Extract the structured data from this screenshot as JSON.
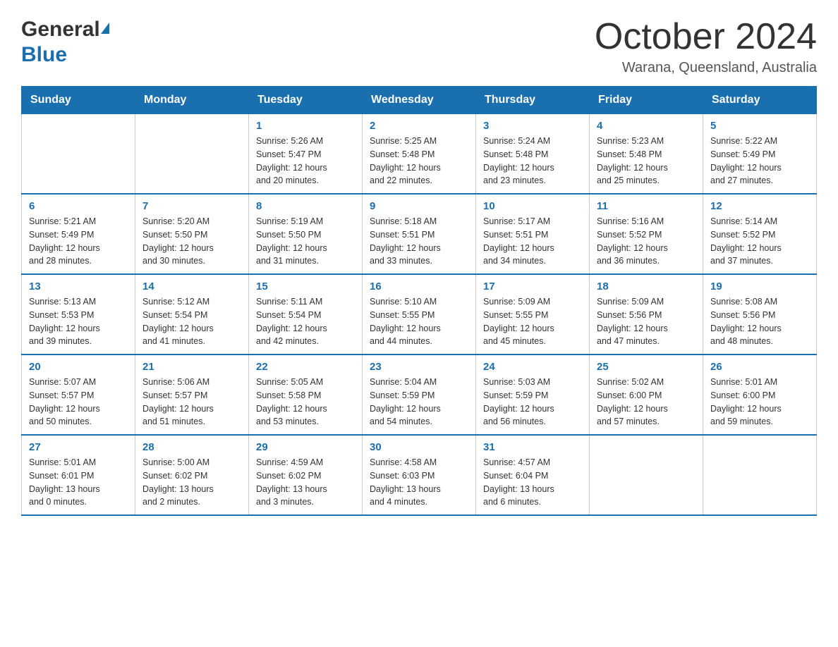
{
  "header": {
    "logo_general": "General",
    "logo_blue": "Blue",
    "month_title": "October 2024",
    "location": "Warana, Queensland, Australia"
  },
  "days_of_week": [
    "Sunday",
    "Monday",
    "Tuesday",
    "Wednesday",
    "Thursday",
    "Friday",
    "Saturday"
  ],
  "weeks": [
    [
      {
        "day": "",
        "info": ""
      },
      {
        "day": "",
        "info": ""
      },
      {
        "day": "1",
        "info": "Sunrise: 5:26 AM\nSunset: 5:47 PM\nDaylight: 12 hours\nand 20 minutes."
      },
      {
        "day": "2",
        "info": "Sunrise: 5:25 AM\nSunset: 5:48 PM\nDaylight: 12 hours\nand 22 minutes."
      },
      {
        "day": "3",
        "info": "Sunrise: 5:24 AM\nSunset: 5:48 PM\nDaylight: 12 hours\nand 23 minutes."
      },
      {
        "day": "4",
        "info": "Sunrise: 5:23 AM\nSunset: 5:48 PM\nDaylight: 12 hours\nand 25 minutes."
      },
      {
        "day": "5",
        "info": "Sunrise: 5:22 AM\nSunset: 5:49 PM\nDaylight: 12 hours\nand 27 minutes."
      }
    ],
    [
      {
        "day": "6",
        "info": "Sunrise: 5:21 AM\nSunset: 5:49 PM\nDaylight: 12 hours\nand 28 minutes."
      },
      {
        "day": "7",
        "info": "Sunrise: 5:20 AM\nSunset: 5:50 PM\nDaylight: 12 hours\nand 30 minutes."
      },
      {
        "day": "8",
        "info": "Sunrise: 5:19 AM\nSunset: 5:50 PM\nDaylight: 12 hours\nand 31 minutes."
      },
      {
        "day": "9",
        "info": "Sunrise: 5:18 AM\nSunset: 5:51 PM\nDaylight: 12 hours\nand 33 minutes."
      },
      {
        "day": "10",
        "info": "Sunrise: 5:17 AM\nSunset: 5:51 PM\nDaylight: 12 hours\nand 34 minutes."
      },
      {
        "day": "11",
        "info": "Sunrise: 5:16 AM\nSunset: 5:52 PM\nDaylight: 12 hours\nand 36 minutes."
      },
      {
        "day": "12",
        "info": "Sunrise: 5:14 AM\nSunset: 5:52 PM\nDaylight: 12 hours\nand 37 minutes."
      }
    ],
    [
      {
        "day": "13",
        "info": "Sunrise: 5:13 AM\nSunset: 5:53 PM\nDaylight: 12 hours\nand 39 minutes."
      },
      {
        "day": "14",
        "info": "Sunrise: 5:12 AM\nSunset: 5:54 PM\nDaylight: 12 hours\nand 41 minutes."
      },
      {
        "day": "15",
        "info": "Sunrise: 5:11 AM\nSunset: 5:54 PM\nDaylight: 12 hours\nand 42 minutes."
      },
      {
        "day": "16",
        "info": "Sunrise: 5:10 AM\nSunset: 5:55 PM\nDaylight: 12 hours\nand 44 minutes."
      },
      {
        "day": "17",
        "info": "Sunrise: 5:09 AM\nSunset: 5:55 PM\nDaylight: 12 hours\nand 45 minutes."
      },
      {
        "day": "18",
        "info": "Sunrise: 5:09 AM\nSunset: 5:56 PM\nDaylight: 12 hours\nand 47 minutes."
      },
      {
        "day": "19",
        "info": "Sunrise: 5:08 AM\nSunset: 5:56 PM\nDaylight: 12 hours\nand 48 minutes."
      }
    ],
    [
      {
        "day": "20",
        "info": "Sunrise: 5:07 AM\nSunset: 5:57 PM\nDaylight: 12 hours\nand 50 minutes."
      },
      {
        "day": "21",
        "info": "Sunrise: 5:06 AM\nSunset: 5:57 PM\nDaylight: 12 hours\nand 51 minutes."
      },
      {
        "day": "22",
        "info": "Sunrise: 5:05 AM\nSunset: 5:58 PM\nDaylight: 12 hours\nand 53 minutes."
      },
      {
        "day": "23",
        "info": "Sunrise: 5:04 AM\nSunset: 5:59 PM\nDaylight: 12 hours\nand 54 minutes."
      },
      {
        "day": "24",
        "info": "Sunrise: 5:03 AM\nSunset: 5:59 PM\nDaylight: 12 hours\nand 56 minutes."
      },
      {
        "day": "25",
        "info": "Sunrise: 5:02 AM\nSunset: 6:00 PM\nDaylight: 12 hours\nand 57 minutes."
      },
      {
        "day": "26",
        "info": "Sunrise: 5:01 AM\nSunset: 6:00 PM\nDaylight: 12 hours\nand 59 minutes."
      }
    ],
    [
      {
        "day": "27",
        "info": "Sunrise: 5:01 AM\nSunset: 6:01 PM\nDaylight: 13 hours\nand 0 minutes."
      },
      {
        "day": "28",
        "info": "Sunrise: 5:00 AM\nSunset: 6:02 PM\nDaylight: 13 hours\nand 2 minutes."
      },
      {
        "day": "29",
        "info": "Sunrise: 4:59 AM\nSunset: 6:02 PM\nDaylight: 13 hours\nand 3 minutes."
      },
      {
        "day": "30",
        "info": "Sunrise: 4:58 AM\nSunset: 6:03 PM\nDaylight: 13 hours\nand 4 minutes."
      },
      {
        "day": "31",
        "info": "Sunrise: 4:57 AM\nSunset: 6:04 PM\nDaylight: 13 hours\nand 6 minutes."
      },
      {
        "day": "",
        "info": ""
      },
      {
        "day": "",
        "info": ""
      }
    ]
  ]
}
